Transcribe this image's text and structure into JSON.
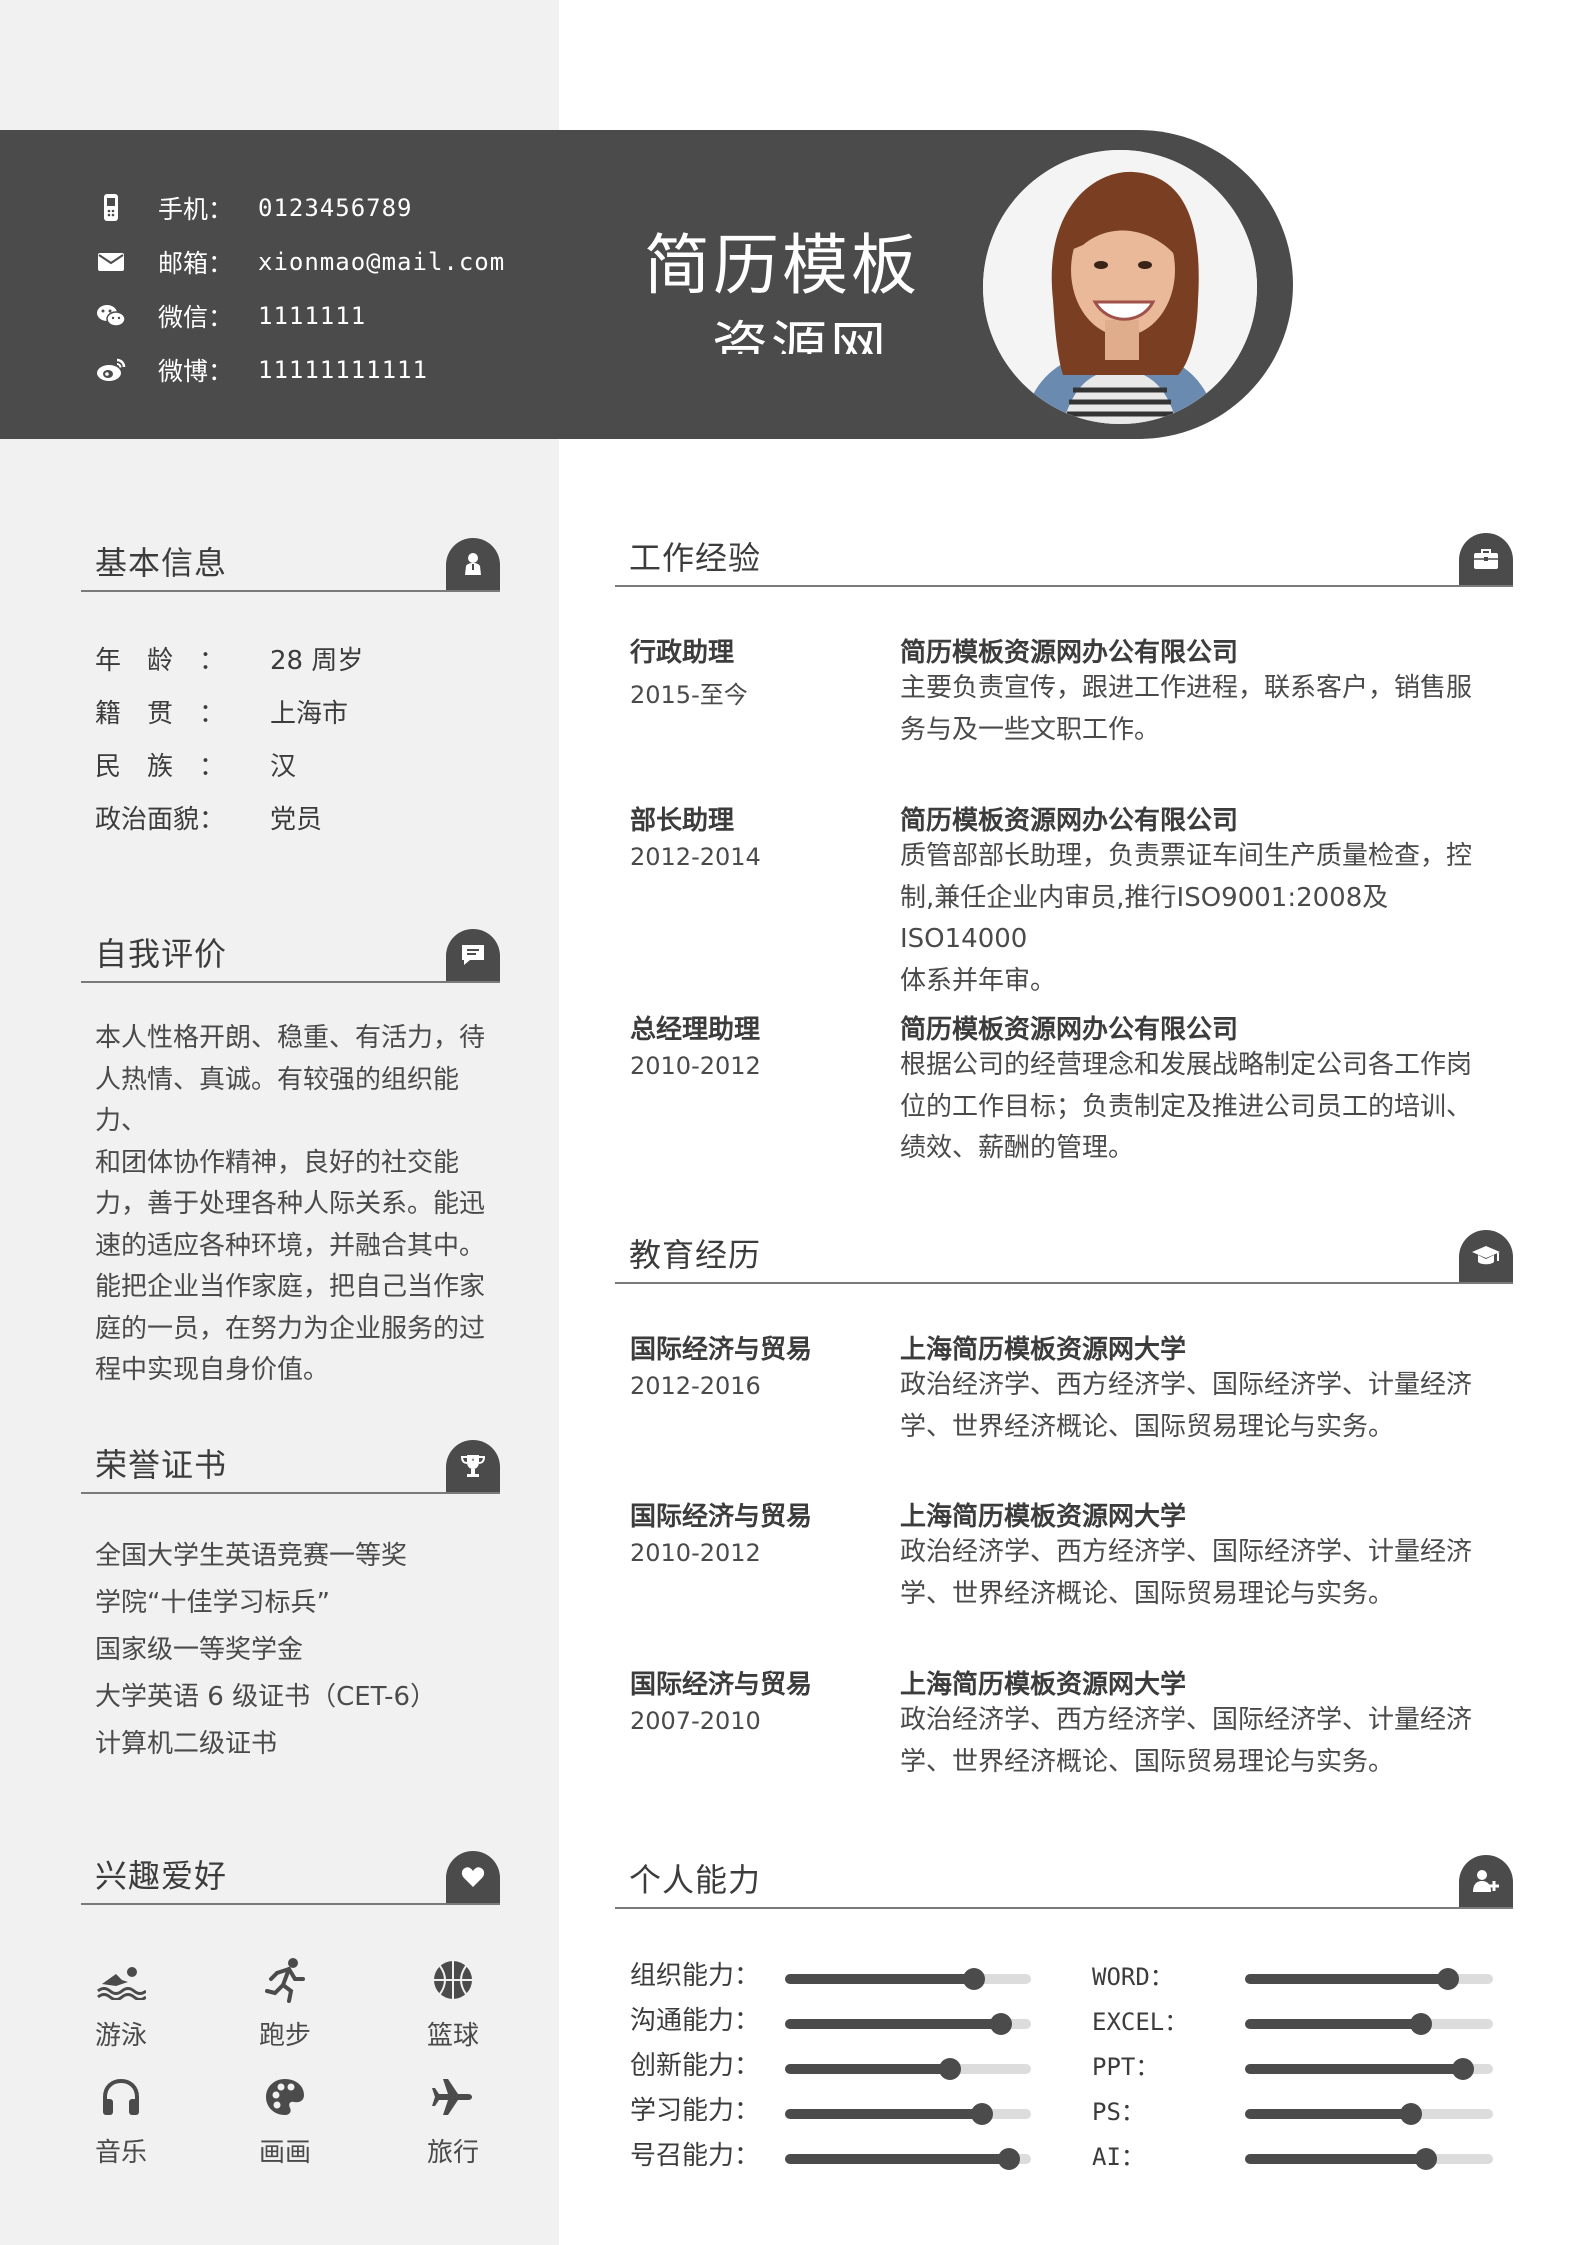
{
  "colors": {
    "dark": "#4b4b4b",
    "left_bg": "#f1f1f1",
    "track": "#dcdcdc"
  },
  "header": {
    "title": "简历模板",
    "subtitle": "资源网",
    "contacts": [
      {
        "icon": "phone-icon",
        "label": "手机：",
        "value": "0123456789"
      },
      {
        "icon": "mail-icon",
        "label": "邮箱：",
        "value": "xionmao@mail.com"
      },
      {
        "icon": "wechat-icon",
        "label": "微信：",
        "value": "1111111"
      },
      {
        "icon": "weibo-icon",
        "label": "微博：",
        "value": "11111111111"
      }
    ]
  },
  "basic": {
    "title": "基本信息",
    "rows": [
      {
        "k": "年　龄　：",
        "v": "28 周岁"
      },
      {
        "k": "籍　贯　：",
        "v": "上海市"
      },
      {
        "k": "民　族　：",
        "v": "汉"
      },
      {
        "k": "政治面貌：",
        "v": "党员"
      }
    ]
  },
  "self": {
    "title": "自我评价",
    "lines": [
      "本人性格开朗、稳重、有活力，待",
      "人热情、真诚。有较强的组织能力、",
      "和团体协作精神，良好的社交能",
      "力，善于处理各种人际关系。能迅",
      "速的适应各种环境，并融合其中。",
      "能把企业当作家庭，把自己当作家",
      "庭的一员，在努力为企业服务的过",
      "程中实现自身价值。"
    ]
  },
  "honors": {
    "title": "荣誉证书",
    "items": [
      "全国大学生英语竞赛一等奖",
      "学院“十佳学习标兵”",
      "国家级一等奖学金",
      "大学英语 6 级证书（CET-6）",
      "计算机二级证书"
    ]
  },
  "hobbies": {
    "title": "兴趣爱好",
    "items": [
      {
        "icon": "swim-icon",
        "label": "游泳"
      },
      {
        "icon": "run-icon",
        "label": "跑步"
      },
      {
        "icon": "basketball-icon",
        "label": "篮球"
      },
      {
        "icon": "headphones-icon",
        "label": "音乐"
      },
      {
        "icon": "palette-icon",
        "label": "画画"
      },
      {
        "icon": "plane-icon",
        "label": "旅行"
      }
    ]
  },
  "work": {
    "title": "工作经验",
    "items": [
      {
        "role": "行政助理",
        "period": "2015-至今",
        "company": "简历模板资源网办公有限公司",
        "lines": [
          "主要负责宣传，跟进工作进程，联系客户，销售服",
          "务与及一些文职工作。"
        ]
      },
      {
        "role": "部长助理",
        "period": "2012-2014",
        "company": "简历模板资源网办公有限公司",
        "lines": [
          "质管部部长助理，负责票证车间生产质量检查，控",
          "制,兼任企业内审员,推行ISO9001:2008及ISO14000",
          "体系并年审。"
        ]
      },
      {
        "role": "总经理助理",
        "period": "2010-2012",
        "company": "简历模板资源网办公有限公司",
        "lines": [
          "根据公司的经营理念和发展战略制定公司各工作岗",
          "位的工作目标；负责制定及推进公司员工的培训、",
          "绩效、薪酬的管理。"
        ]
      }
    ]
  },
  "education": {
    "title": "教育经历",
    "items": [
      {
        "major": "国际经济与贸易",
        "period": "2012-2016",
        "school": "上海简历模板资源网大学",
        "lines": [
          "政治经济学、西方经济学、国际经济学、计量经济",
          "学、世界经济概论、国际贸易理论与实务。"
        ]
      },
      {
        "major": "国际经济与贸易",
        "period": "2010-2012",
        "school": "上海简历模板资源网大学",
        "lines": [
          "政治经济学、西方经济学、国际经济学、计量经济",
          "学、世界经济概论、国际贸易理论与实务。"
        ]
      },
      {
        "major": "国际经济与贸易",
        "period": "2007-2010",
        "school": "上海简历模板资源网大学",
        "lines": [
          "政治经济学、西方经济学、国际经济学、计量经济",
          "学、世界经济概论、国际贸易理论与实务。"
        ]
      }
    ]
  },
  "skills": {
    "title": "个人能力",
    "left": [
      {
        "label": "组织能力：",
        "level": 0.77
      },
      {
        "label": "沟通能力：",
        "level": 0.88
      },
      {
        "label": "创新能力：",
        "level": 0.67
      },
      {
        "label": "学习能力：",
        "level": 0.8
      },
      {
        "label": "号召能力：",
        "level": 0.91
      }
    ],
    "right": [
      {
        "label": "WORD：",
        "level": 0.82
      },
      {
        "label": "EXCEL：",
        "level": 0.71
      },
      {
        "label": "PPT：",
        "level": 0.88
      },
      {
        "label": "PS：",
        "level": 0.67
      },
      {
        "label": "AI：",
        "level": 0.73
      }
    ]
  }
}
